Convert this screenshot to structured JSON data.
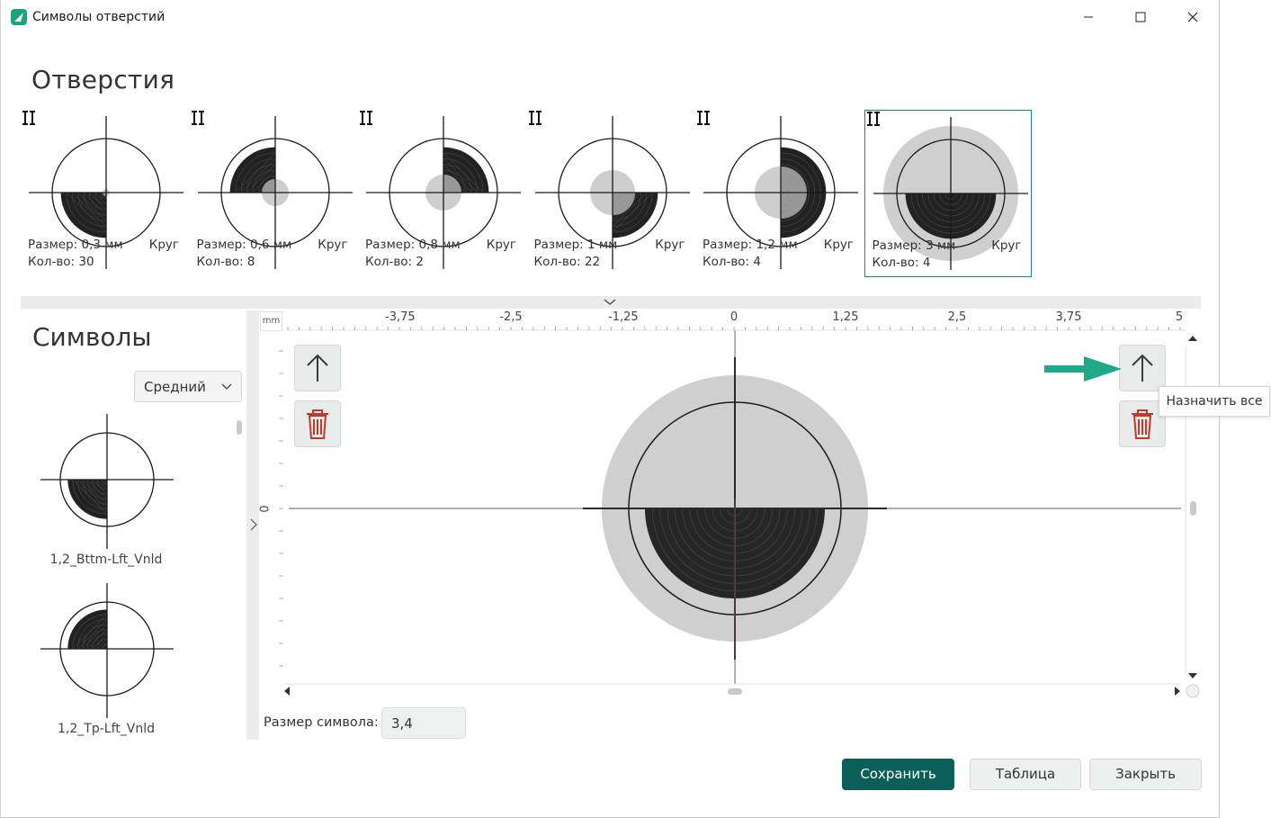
{
  "window": {
    "title": "Символы отверстий",
    "controls": {
      "minimize": "minimize-icon",
      "maximize": "maximize-icon",
      "close": "close-icon"
    }
  },
  "holes": {
    "heading": "Отверстия",
    "size_label": "Размер:",
    "count_label": "Кол-во:",
    "items": [
      {
        "size": "0,3 мм",
        "count": "30",
        "shape": "Круг",
        "fill_quadrant": "bottom-left",
        "selected": false
      },
      {
        "size": "0,6 мм",
        "count": "8",
        "shape": "Круг",
        "fill_quadrant": "top-left",
        "selected": false
      },
      {
        "size": "0,8 мм",
        "count": "2",
        "shape": "Круг",
        "fill_quadrant": "top-right",
        "selected": false
      },
      {
        "size": "1 мм",
        "count": "22",
        "shape": "Круг",
        "fill_quadrant": "bottom-right",
        "selected": false
      },
      {
        "size": "1,2 мм",
        "count": "4",
        "shape": "Круг",
        "fill_quadrant": "right-half",
        "selected": false
      },
      {
        "size": "3 мм",
        "count": "4",
        "shape": "Круг",
        "fill_quadrant": "bottom-half",
        "selected": true
      }
    ]
  },
  "symbols": {
    "heading": "Символы",
    "size_filter": {
      "selected": "Средний"
    },
    "list": [
      {
        "label": "1,2_Bttm-Lft_Vnld",
        "fill_quadrant": "bottom-left"
      },
      {
        "label": "1,2_Tp-Lft_Vnld",
        "fill_quadrant": "top-left"
      }
    ]
  },
  "editor": {
    "ruler_unit": "mm",
    "x_ticks": [
      "-3,75",
      "-2,5",
      "-1,25",
      "0",
      "1,25",
      "2,5",
      "3,75",
      "5"
    ],
    "y_zero_label": "0",
    "tooltip": "Назначить все",
    "symbol_size_label": "Размер символа:",
    "symbol_size_value": "3,4"
  },
  "footer": {
    "save": "Сохранить",
    "table": "Таблица",
    "close": "Закрыть"
  },
  "colors": {
    "accent": "#0b5e5a",
    "selected_border": "#19827a",
    "arrow": "#1fa88a",
    "delete": "#c0392b",
    "hole_gray": "#cfcfcf",
    "fill_dark": "#222222"
  }
}
